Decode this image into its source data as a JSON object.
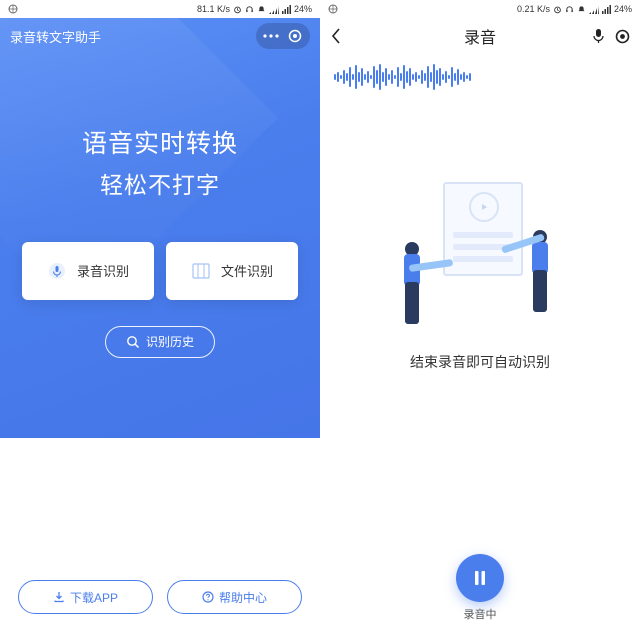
{
  "status_left": {
    "speed": "81.1 K/s",
    "battery": "24%"
  },
  "status_right": {
    "speed": "0.21 K/s",
    "battery": "24%"
  },
  "left": {
    "app_title": "录音转文字助手",
    "hero_line1": "语音实时转换",
    "hero_line2": "轻松不打字",
    "card_record": "录音识别",
    "card_file": "文件识别",
    "history": "识别历史",
    "download": "下载APP",
    "help": "帮助中心"
  },
  "right": {
    "title": "录音",
    "illus_text": "结束录音即可自动识别",
    "rec_label": "录音中"
  },
  "wave_heights": [
    6,
    10,
    4,
    14,
    8,
    20,
    6,
    24,
    10,
    18,
    6,
    12,
    4,
    22,
    14,
    26,
    10,
    18,
    6,
    14,
    4,
    20,
    8,
    24,
    12,
    18,
    6,
    10,
    4,
    14,
    8,
    22,
    10,
    26,
    14,
    18,
    6,
    12,
    4,
    20,
    8,
    16,
    6,
    10,
    4,
    8
  ]
}
